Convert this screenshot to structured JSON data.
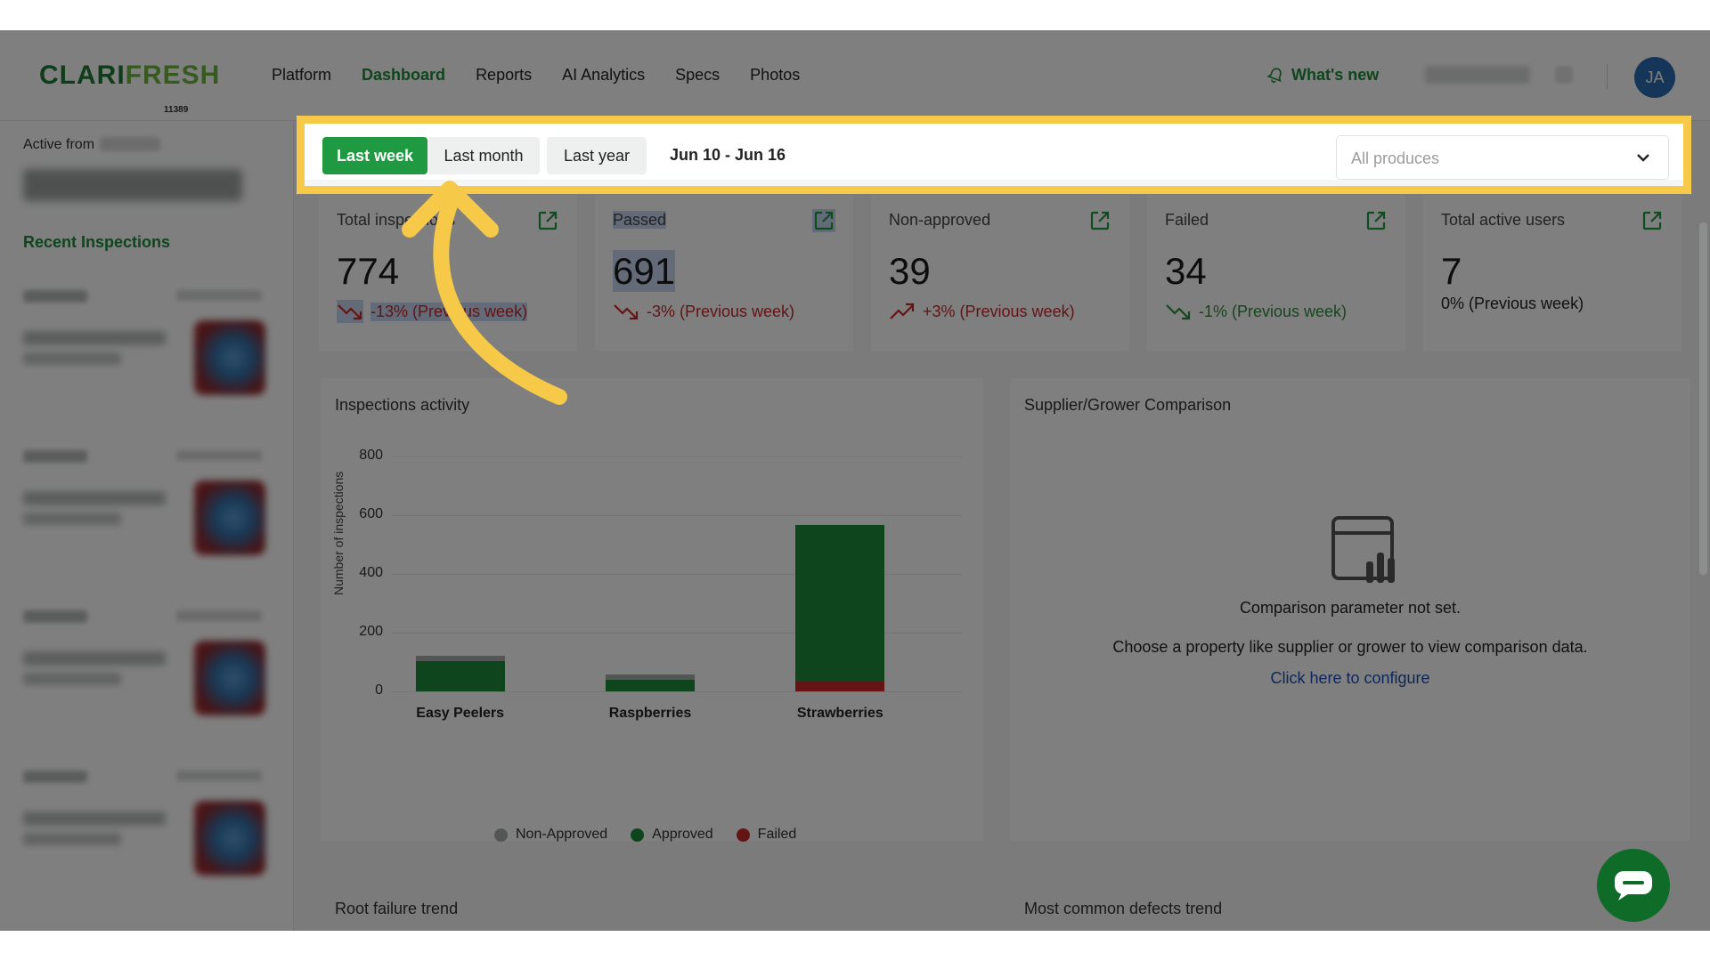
{
  "nav": {
    "logo_part1": "CLARI",
    "logo_part2": "FRESH",
    "logo_sub": "11389",
    "items": [
      {
        "label": "Platform",
        "active": false
      },
      {
        "label": "Dashboard",
        "active": true
      },
      {
        "label": "Reports",
        "active": false
      },
      {
        "label": "AI Analytics",
        "active": false
      },
      {
        "label": "Specs",
        "active": false
      },
      {
        "label": "Photos",
        "active": false
      }
    ],
    "whats_new": "What's new",
    "avatar_initials": "JA"
  },
  "sidebar": {
    "active_from_label": "Active from",
    "recent_title": "Recent Inspections"
  },
  "filters": {
    "ranges": [
      "Last week",
      "Last month",
      "Last year"
    ],
    "active_range": "Last week",
    "date_range": "Jun 10 - Jun 16",
    "produce_placeholder": "All produces"
  },
  "stats": [
    {
      "label": "Total inspections",
      "value": "774",
      "delta": "-13% (Previous week)",
      "trend": "down",
      "tone": "red"
    },
    {
      "label": "Passed",
      "value": "691",
      "delta": "-3% (Previous week)",
      "trend": "down",
      "tone": "red"
    },
    {
      "label": "Non-approved",
      "value": "39",
      "delta": "+3% (Previous week)",
      "trend": "up",
      "tone": "red"
    },
    {
      "label": "Failed",
      "value": "34",
      "delta": "-1% (Previous week)",
      "trend": "down",
      "tone": "green"
    },
    {
      "label": "Total active users",
      "value": "7",
      "delta": "0% (Previous week)",
      "trend": "none",
      "tone": "neutral"
    }
  ],
  "inspections_panel": {
    "title": "Inspections activity"
  },
  "chart_data": {
    "type": "bar",
    "stacked": true,
    "title": "Inspections activity",
    "xlabel": "",
    "ylabel": "Number of inspections",
    "ylim": [
      0,
      800
    ],
    "yticks": [
      0,
      200,
      400,
      600,
      800
    ],
    "categories": [
      "Easy Peelers",
      "Raspberries",
      "Strawberries"
    ],
    "series": [
      {
        "name": "Failed",
        "color": "#c62828",
        "values": [
          0,
          0,
          32
        ]
      },
      {
        "name": "Approved",
        "color": "#1f8b3a",
        "values": [
          102,
          40,
          535
        ]
      },
      {
        "name": "Non-Approved",
        "color": "#a9acab",
        "values": [
          18,
          18,
          0
        ]
      }
    ],
    "legend_order": [
      "Non-Approved",
      "Approved",
      "Failed"
    ],
    "legend": "bottom",
    "grid": true
  },
  "comparison_panel": {
    "title": "Supplier/Grower Comparison",
    "empty_title": "Comparison parameter not set.",
    "empty_desc": "Choose a property like supplier or grower to view comparison data.",
    "link": "Click here to configure"
  },
  "bottom": {
    "root_failure": "Root failure trend",
    "common_defects": "Most common defects trend"
  },
  "colors": {
    "brand_green": "#1f9a42",
    "highlight": "#f7c948",
    "arrow": "#f7c948"
  }
}
